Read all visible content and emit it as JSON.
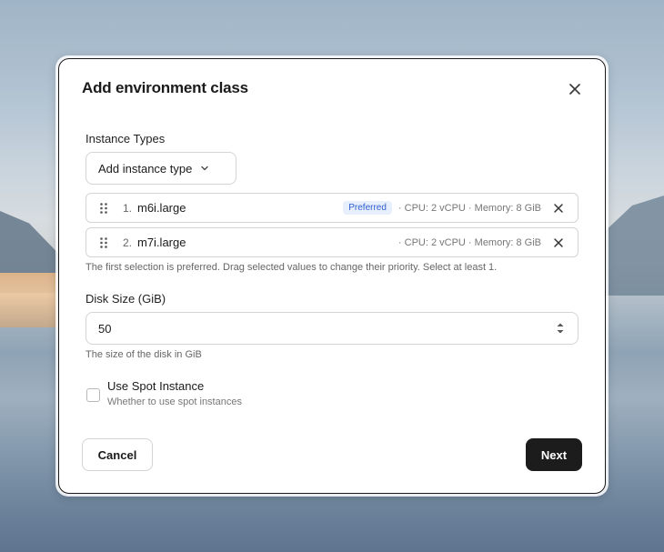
{
  "dialog": {
    "title": "Add environment class",
    "instance_types": {
      "label": "Instance Types",
      "add_button": "Add instance type",
      "items": [
        {
          "index": "1.",
          "name": "m6i.large",
          "badge": "Preferred",
          "specs": "· CPU: 2 vCPU · Memory: 8 GiB"
        },
        {
          "index": "2.",
          "name": "m7i.large",
          "badge": "",
          "specs": "· CPU: 2 vCPU · Memory: 8 GiB"
        }
      ],
      "help": "The first selection is preferred. Drag selected values to change their priority. Select at least 1."
    },
    "disk_size": {
      "label": "Disk Size (GiB)",
      "value": "50",
      "help": "The size of the disk in GiB"
    },
    "spot": {
      "checked": false,
      "label": "Use Spot Instance",
      "description": "Whether to use spot instances"
    },
    "footer": {
      "cancel_label": "Cancel",
      "next_label": "Next"
    }
  },
  "colors": {
    "primary_button": "#1c1c1c",
    "badge_text": "#2f5fd0",
    "badge_bg": "#e7eefc"
  },
  "icons": {
    "close": "close-icon",
    "chevron": "chevron-down-icon",
    "drag": "drag-handle-icon",
    "remove": "remove-icon",
    "stepper": "stepper-icon"
  }
}
